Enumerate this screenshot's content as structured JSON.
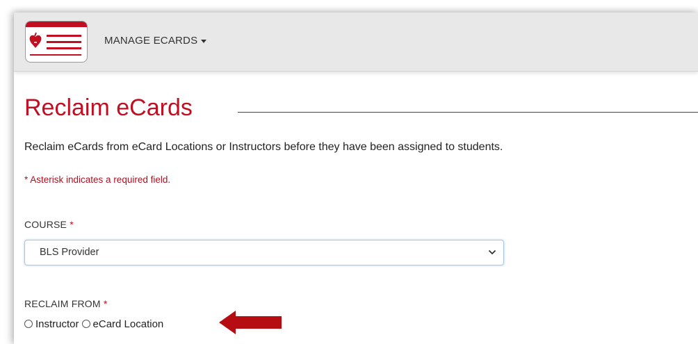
{
  "navbar": {
    "menu_label": "MANAGE ECARDS"
  },
  "page": {
    "title": "Reclaim eCards",
    "description": "Reclaim eCards from eCard Locations or Instructors before they have been assigned to students.",
    "required_note": "* Asterisk indicates a required field."
  },
  "course": {
    "label": "COURSE",
    "required_marker": "*",
    "selected": "BLS Provider"
  },
  "reclaim_from": {
    "label": "RECLAIM FROM",
    "required_marker": "*",
    "options": [
      {
        "label": "Instructor",
        "selected": false
      },
      {
        "label": "eCard Location",
        "selected": false
      }
    ]
  },
  "colors": {
    "brand_red": "#c10e21",
    "navbar_bg": "#e8e8e8",
    "annotation_arrow": "#b50d12"
  },
  "icons": {
    "logo": "aha-heart-card-logo",
    "dropdown_caret": "caret-down-icon",
    "select_chevron": "chevron-down-icon",
    "annotation": "arrow-left-icon"
  }
}
